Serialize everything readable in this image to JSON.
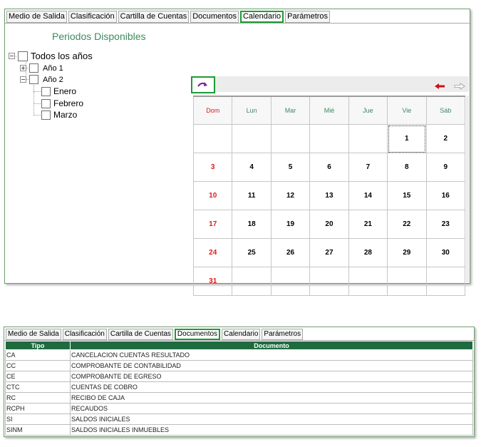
{
  "top_panel": {
    "tabs": [
      {
        "label": "Medio de Salida",
        "active": false
      },
      {
        "label": "Clasificación",
        "active": false
      },
      {
        "label": "Cartilla de Cuentas",
        "active": false
      },
      {
        "label": "Documentos",
        "active": false
      },
      {
        "label": "Calendario",
        "active": true
      },
      {
        "label": "Parámetros",
        "active": false
      }
    ],
    "periods_title": "Periodos Disponibles",
    "tree": {
      "root": {
        "label": "Todos los años",
        "expander": "−"
      },
      "year1": {
        "label": "Año 1",
        "expander": "+"
      },
      "year2": {
        "label": "Año 2",
        "expander": "−"
      },
      "months": [
        "Enero",
        "Febrero",
        "Marzo"
      ]
    },
    "calendar": {
      "days": [
        "Dom",
        "Lun",
        "Mar",
        "Mié",
        "Jue",
        "Vie",
        "Sáb"
      ],
      "weeks": [
        [
          "",
          "",
          "",
          "",
          "",
          "1",
          "2"
        ],
        [
          "3",
          "4",
          "5",
          "6",
          "7",
          "8",
          "9"
        ],
        [
          "10",
          "11",
          "12",
          "13",
          "14",
          "15",
          "16"
        ],
        [
          "17",
          "18",
          "19",
          "20",
          "21",
          "22",
          "23"
        ],
        [
          "24",
          "25",
          "26",
          "27",
          "28",
          "29",
          "30"
        ],
        [
          "31",
          "",
          "",
          "",
          "",
          "",
          ""
        ]
      ],
      "today": "1",
      "colors": {
        "sunday": "#e01a1a",
        "header": "#3c8a5e",
        "nav_prev": "#cc1111",
        "refresh": "#7a1b8c"
      }
    }
  },
  "bottom_panel": {
    "tabs": [
      {
        "label": "Medio de Salida",
        "active": false
      },
      {
        "label": "Clasificación",
        "active": false
      },
      {
        "label": "Cartilla de Cuentas",
        "active": false
      },
      {
        "label": "Documentos",
        "active": true
      },
      {
        "label": "Calendario",
        "active": false
      },
      {
        "label": "Parámetros",
        "active": false
      }
    ],
    "table": {
      "headers": [
        "Tipo",
        "Documento"
      ],
      "rows": [
        [
          "CA",
          "CANCELACION CUENTAS RESULTADO"
        ],
        [
          "CC",
          "COMPROBANTE DE CONTABILIDAD"
        ],
        [
          "CE",
          "COMPROBANTE DE EGRESO"
        ],
        [
          "CTC",
          "CUENTAS DE COBRO"
        ],
        [
          "RC",
          "RECIBO DE CAJA"
        ],
        [
          "RCPH",
          "RECAUDOS"
        ],
        [
          "SI",
          "SALDOS INICIALES"
        ],
        [
          "SINM",
          "SALDOS INICIALES INMUEBLES"
        ]
      ]
    },
    "colors": {
      "header_bg": "#1f6b40",
      "active_tab_border": "#1d9b34"
    }
  }
}
